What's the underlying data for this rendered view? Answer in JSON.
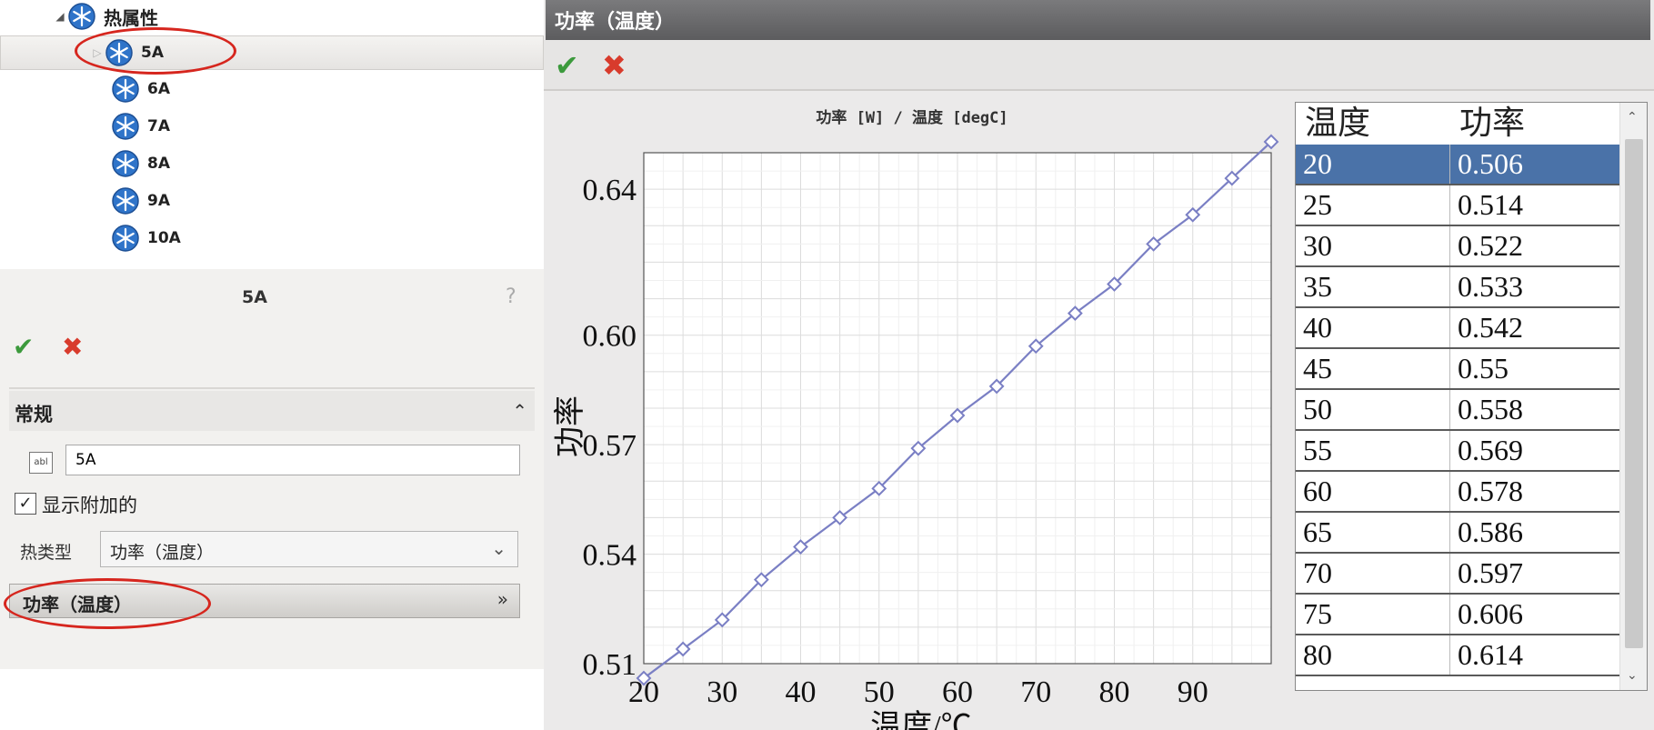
{
  "tree": {
    "root": {
      "label": "热属性"
    },
    "items": [
      {
        "label": "5A",
        "selected": true
      },
      {
        "label": "6A"
      },
      {
        "label": "7A"
      },
      {
        "label": "8A"
      },
      {
        "label": "9A"
      },
      {
        "label": "10A"
      }
    ]
  },
  "property_manager": {
    "title": "5A",
    "help": "?",
    "ok": "✔",
    "cancel": "✖",
    "section": "常规",
    "collapse": "⌃",
    "abl_icon": "abl",
    "name_value": "5A",
    "show_additional": {
      "label": "显示附加的",
      "checked": true,
      "mark": "✓"
    },
    "heat_type": {
      "label": "热类型",
      "value": "功率（温度）",
      "caret": "⌄"
    },
    "table_button": {
      "label": "功率（温度）",
      "arrow": "»"
    }
  },
  "dialog": {
    "title": "功率（温度）",
    "ok": "✔",
    "cancel": "✖"
  },
  "chart_data": {
    "type": "line",
    "title": "功率 [W] / 温度 [degC]",
    "xlabel": "温度/℃",
    "ylabel": "功率",
    "xlim": [
      20,
      100
    ],
    "ylim": [
      0.51,
      0.65
    ],
    "x_ticks": [
      20,
      30,
      40,
      50,
      60,
      70,
      80,
      90
    ],
    "y_ticks": [
      0.51,
      0.54,
      0.57,
      0.6,
      0.64
    ],
    "y_tick_labels": [
      "0.51",
      "0.54",
      "0.57",
      "0.60",
      "0.64"
    ],
    "grid": true,
    "x": [
      20,
      25,
      30,
      35,
      40,
      45,
      50,
      55,
      60,
      65,
      70,
      75,
      80,
      85,
      90,
      95,
      100
    ],
    "values": [
      0.506,
      0.514,
      0.522,
      0.533,
      0.542,
      0.55,
      0.558,
      0.569,
      0.578,
      0.586,
      0.597,
      0.606,
      0.614,
      0.625,
      0.633,
      0.643,
      0.653
    ],
    "line_color": "#7a7fc4"
  },
  "table": {
    "headers": [
      "温度",
      "功率"
    ],
    "rows": [
      [
        "20",
        "0.506"
      ],
      [
        "25",
        "0.514"
      ],
      [
        "30",
        "0.522"
      ],
      [
        "35",
        "0.533"
      ],
      [
        "40",
        "0.542"
      ],
      [
        "45",
        "0.55"
      ],
      [
        "50",
        "0.558"
      ],
      [
        "55",
        "0.569"
      ],
      [
        "60",
        "0.578"
      ],
      [
        "65",
        "0.586"
      ],
      [
        "70",
        "0.597"
      ],
      [
        "75",
        "0.606"
      ],
      [
        "80",
        "0.614"
      ]
    ],
    "selected_row": 0,
    "scroll_up": "⌃",
    "scroll_down": "⌄"
  },
  "colors": {
    "selection": "#4a72a8",
    "annotation_ring": "#d6261e",
    "ok_green": "#3c9a3c",
    "cancel_red": "#d83b2c"
  }
}
